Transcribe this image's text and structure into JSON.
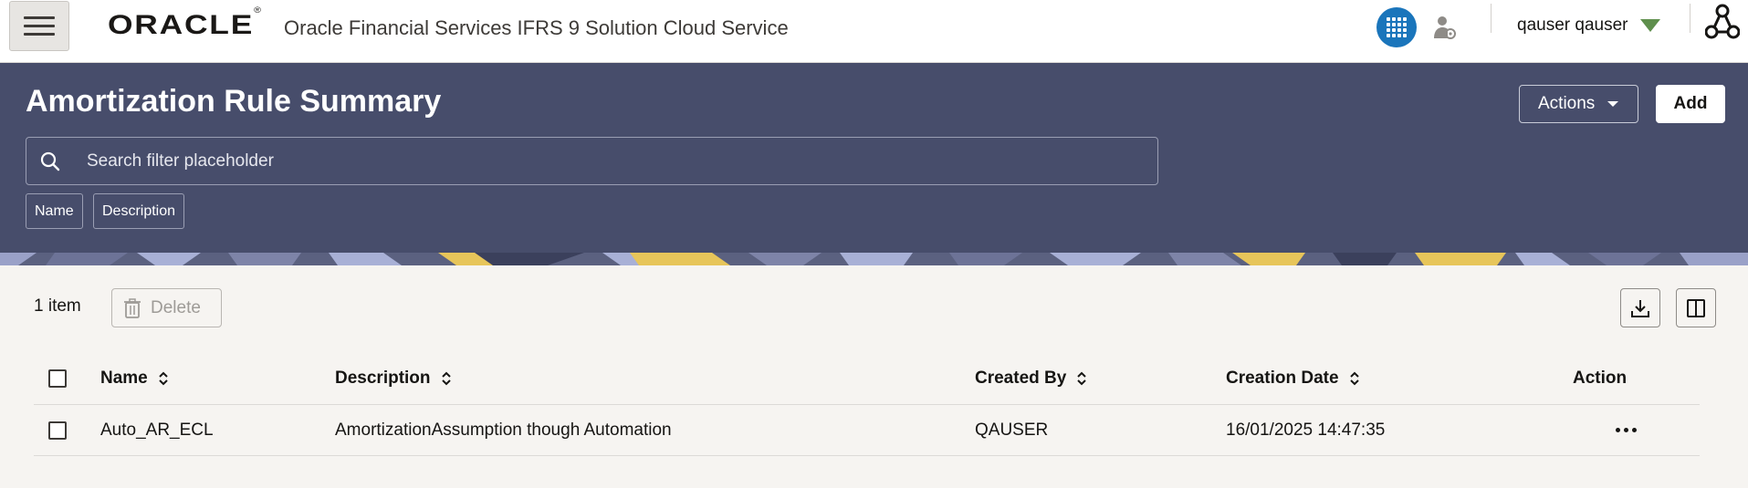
{
  "header": {
    "logo_text": "ORACLE",
    "logo_mark": "®",
    "app_title": "Oracle Financial Services IFRS 9 Solution Cloud Service",
    "user_name": "qauser qauser",
    "icons": [
      "menu-icon",
      "app-grid-icon",
      "user-settings-icon",
      "chevron-down-icon",
      "hierarchy-icon"
    ]
  },
  "hero": {
    "title": "Amortization Rule Summary",
    "actions_label": "Actions",
    "add_label": "Add",
    "search_placeholder": "Search filter placeholder",
    "filter_chips": [
      "Name",
      "Description"
    ]
  },
  "toolbar": {
    "count_label": "1 item",
    "delete_label": "Delete",
    "icons": [
      "download-icon",
      "columns-icon"
    ]
  },
  "table": {
    "columns": [
      "Name",
      "Description",
      "Created By",
      "Creation Date",
      "Action"
    ],
    "rows": [
      {
        "name": "Auto_AR_ECL",
        "description": "AmortizationAssumption though Automation",
        "created_by": "QAUSER",
        "creation_date": "16/01/2025 14:47:35"
      }
    ]
  },
  "colors": {
    "hero_bg": "#474d6b",
    "accent_blue": "#1a75bb",
    "user_caret": "#5f8f4d",
    "page_bg": "#f6f4f1"
  }
}
